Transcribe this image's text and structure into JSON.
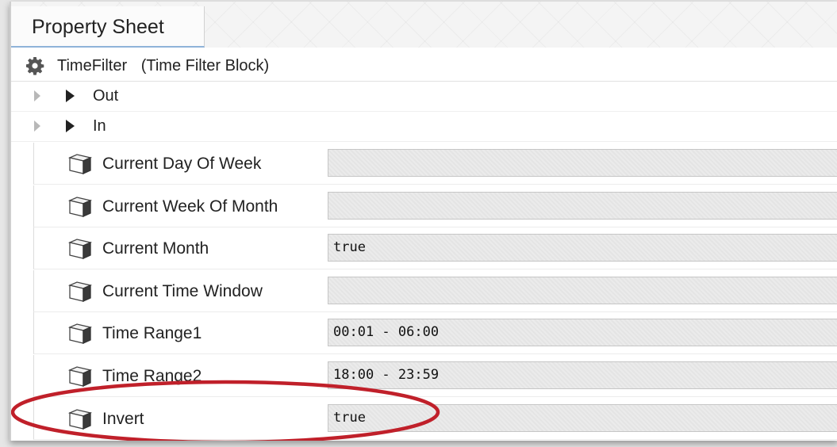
{
  "tab": {
    "label": "Property Sheet"
  },
  "component": {
    "name": "TimeFilter",
    "type": "(Time Filter Block)"
  },
  "slots": [
    {
      "label": "Out"
    },
    {
      "label": "In"
    }
  ],
  "properties": [
    {
      "label": "Current Day Of Week",
      "value": ""
    },
    {
      "label": "Current Week Of Month",
      "value": ""
    },
    {
      "label": "Current Month",
      "value": "true"
    },
    {
      "label": "Current Time Window",
      "value": ""
    },
    {
      "label": "Time Range1",
      "value": "00:01 - 06:00"
    },
    {
      "label": "Time Range2",
      "value": "18:00 - 23:59"
    },
    {
      "label": "Invert",
      "value": "true"
    }
  ],
  "annotation": {
    "color": "#c0202a"
  },
  "icons": {
    "component": "gear-icon",
    "property": "cube-icon"
  }
}
